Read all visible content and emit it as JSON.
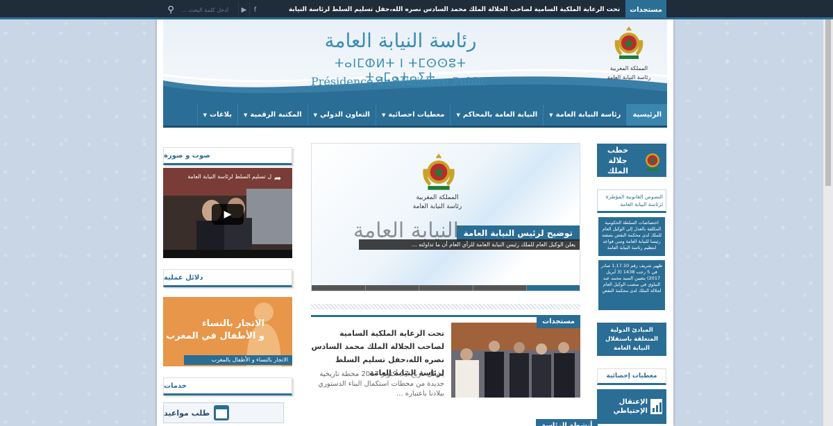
{
  "topbar": {
    "ticker_label": "مستجدات",
    "ticker_text": "تحت الرعاية الملكية السامية لصاحب الجلالة الملك محمد السادس نصره الله،حفل تسليم السلط لرئاسة النيابة",
    "search_placeholder": "أدخل كلمة البحث ...",
    "search_icon": "search-icon",
    "social_icons": [
      "youtube-icon",
      "facebook-icon"
    ],
    "youtube_glyph": "▶",
    "facebook_glyph": "f"
  },
  "header": {
    "title_ar": "رئاسة النيابة العامة",
    "title_tifinagh": "ⵜⴰⵏⵎⵀⵍⵜ ⵏ ⵜⵎⵙⵙⵓⵜ ⵜⴰⵎⴰⵜⴰⵢⵜ",
    "title_fr": "Présidence du Ministère Public",
    "emblem_line1": "المملكة المغربية",
    "emblem_line2": "رئاسة النيابة العامة"
  },
  "nav": {
    "items": [
      {
        "label": "الرئيسية",
        "active": true,
        "has_dropdown": false
      },
      {
        "label": "رئاسة النيابة العامة",
        "active": false,
        "has_dropdown": true
      },
      {
        "label": "النيابة العامة بالمحاكم",
        "active": false,
        "has_dropdown": true
      },
      {
        "label": "معطيات احصائية",
        "active": false,
        "has_dropdown": true
      },
      {
        "label": "التعاون الدولي",
        "active": false,
        "has_dropdown": true
      },
      {
        "label": "المكتبة الرقمية",
        "active": false,
        "has_dropdown": true
      },
      {
        "label": "بلاغات",
        "active": false,
        "has_dropdown": true
      }
    ]
  },
  "left": {
    "media_title": "صوت و صورة",
    "video_title": "ل تسليم السلط لرئاسة النيابة العامة",
    "guides_title": "دلائل عملية",
    "ad_text_line1": "الاتجار بالنساء",
    "ad_text_line2": "و الأطفال في المغرب",
    "ad_strip": "الاتجار بالنساء و الأطفال بالمغرب",
    "services_title": "خدمات",
    "appointment_label": "طلب مواعيد"
  },
  "slider": {
    "emblem_line1": "المملكة المغربية",
    "emblem_line2": "رئاسة النيابة العامة",
    "big_text": "النيابة العامة",
    "caption_title": "توضيح لرئيس النيابة العامة",
    "caption_text": "يعلن الوكيل العام للملك رئيس النيابة العامة للرأي العام أن ما تداولته ...",
    "slide_count": 5,
    "active_slide": 4
  },
  "news": {
    "label": "مستجدات",
    "title": "تحت الرعاية الملكية السامية لصاحب الجلالة الملك محمد السادس نصره الله،حفل تسليم السلط لرئاسة النيابة العامة",
    "excerpt": "يشكل تاريخ 07 أكتوبر 2017 محطة تاريخية جديدة من محطات استكمال البناء الدستوري ببلادنا باعتباره ..."
  },
  "more_label": "أنشطة الرئاسة",
  "right": {
    "king_speech_line1": "خطب",
    "king_speech_line2": "جلالة الملك",
    "legal_texts": "النصوص القانونية المؤطرة لرئاسة النيابة العامة",
    "legal_card1": "اختصاصات السلطة الحكومية المكلفة بالعدل إلى الوكيل العام للملك لدى محكمة النقض بصفته رئيسا للنيابة العامة وسن قواعد لتنظيم رئاسة النيابة العامة",
    "legal_card2": "ظهير شريف رقم 1.17.10 صادر في 5 رجب 1438 (3 أبريل 2017) بتعيين السيد محمد عبد النباوي في منصب الوكيل العام لجلالة الملك لدى محكمة النقض",
    "principles": "المبادئ الدولية المتعلقة باستقلال النيابة العامة",
    "stats_title": "معطيات إحصائية",
    "stats_card": "الإعتقال الإحتياطي"
  }
}
